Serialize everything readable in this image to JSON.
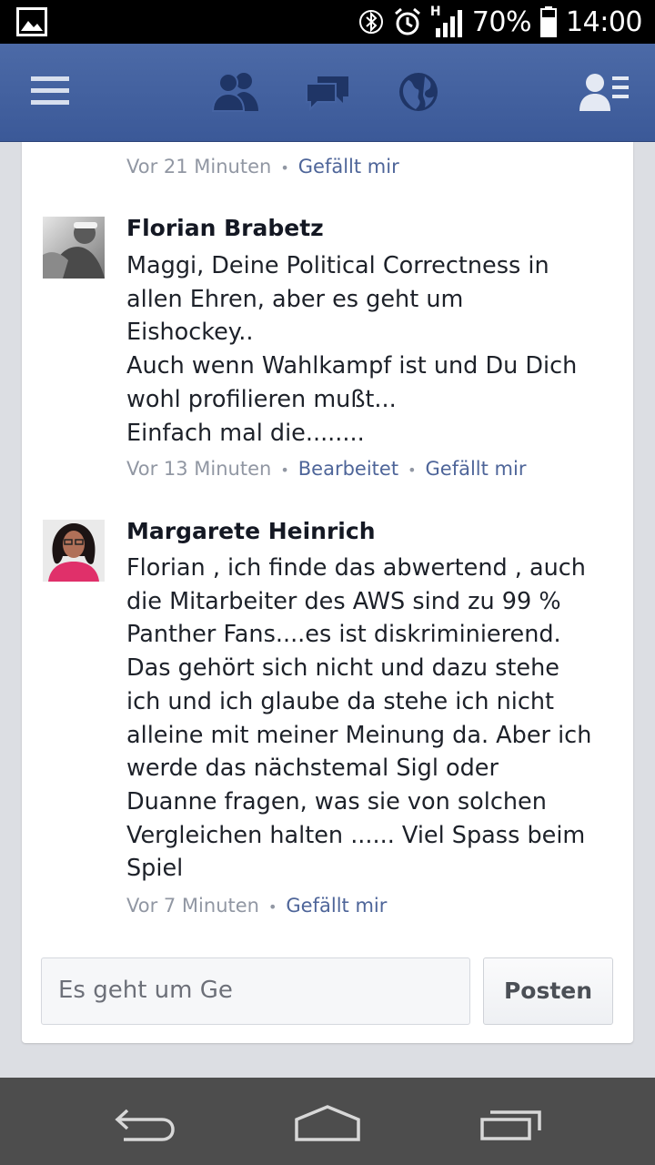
{
  "status_bar": {
    "network_type": "H",
    "battery": "70%",
    "time": "14:00",
    "icons": [
      "gallery-icon",
      "bluetooth-icon",
      "alarm-icon",
      "signal-icon",
      "battery-icon"
    ]
  },
  "app_bar": {
    "icons": [
      "menu-icon",
      "friend-requests-icon",
      "messages-icon",
      "notifications-globe-icon",
      "contacts-icon"
    ],
    "colors": {
      "background": "#3b5998"
    }
  },
  "previous_comment": {
    "time": "Vor 21 Minuten",
    "like_label": "Gefällt mir"
  },
  "comments": [
    {
      "author": "Florian Brabetz",
      "lines": [
        "Maggi, Deine Political Correctness in",
        "allen Ehren, aber es geht um",
        "Eishockey..",
        "Auch wenn Wahlkampf ist und Du Dich",
        "wohl profilieren mußt...",
        "Einfach mal die........"
      ],
      "time": "Vor 13 Minuten",
      "edited_label": "Bearbeitet",
      "like_label": "Gefällt mir"
    },
    {
      "author": "Margarete Heinrich",
      "lines": [
        "Florian , ich finde das abwertend , auch",
        "die Mitarbeiter des AWS sind zu 99 %",
        "Panther Fans....es ist diskriminierend.",
        "Das gehört sich nicht und dazu stehe",
        "ich und ich glaube da stehe ich nicht",
        "alleine mit meiner Meinung da. Aber ich",
        "werde das nächstemal Sigl oder",
        "Duanne fragen, was sie von solchen",
        "Vergleichen halten ...... Viel Spass beim",
        "Spiel"
      ],
      "time": "Vor 7 Minuten",
      "like_label": "Gefällt mir"
    }
  ],
  "composer": {
    "value": "Es geht um Ge",
    "post_label": "Posten"
  },
  "nav_bar": {
    "icons": [
      "back-icon",
      "home-icon",
      "recent-apps-icon"
    ]
  }
}
